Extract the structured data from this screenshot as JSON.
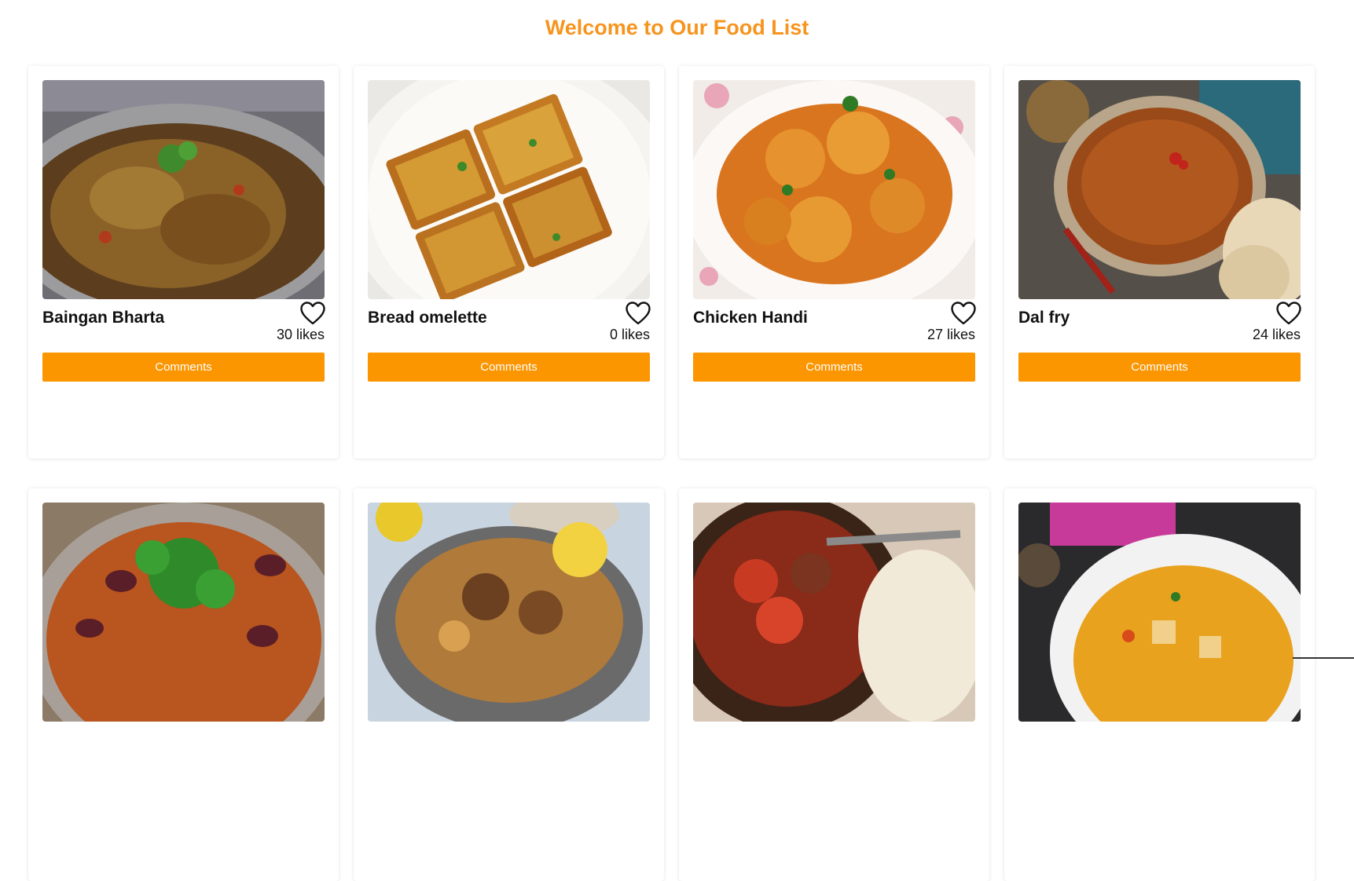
{
  "header": {
    "title": "Welcome to Our Food List"
  },
  "theme": {
    "accent": "#f7941d",
    "button": "#fb9500"
  },
  "cards": [
    {
      "name": "Baingan Bharta",
      "likes": "30 likes",
      "comments_label": "Comments",
      "image": "baingan-bharta-image"
    },
    {
      "name": "Bread omelette",
      "likes": "0 likes",
      "comments_label": "Comments",
      "image": "bread-omelette-image"
    },
    {
      "name": "Chicken Handi",
      "likes": "27 likes",
      "comments_label": "Comments",
      "image": "chicken-handi-image"
    },
    {
      "name": "Dal fry",
      "likes": "24 likes",
      "comments_label": "Comments",
      "image": "dal-fry-image"
    },
    {
      "image": "rajma-curry-image"
    },
    {
      "image": "biryani-image"
    },
    {
      "image": "meat-curry-with-rice-image"
    },
    {
      "image": "vegetable-curry-image"
    }
  ],
  "icons": {
    "like": "heart-icon"
  }
}
